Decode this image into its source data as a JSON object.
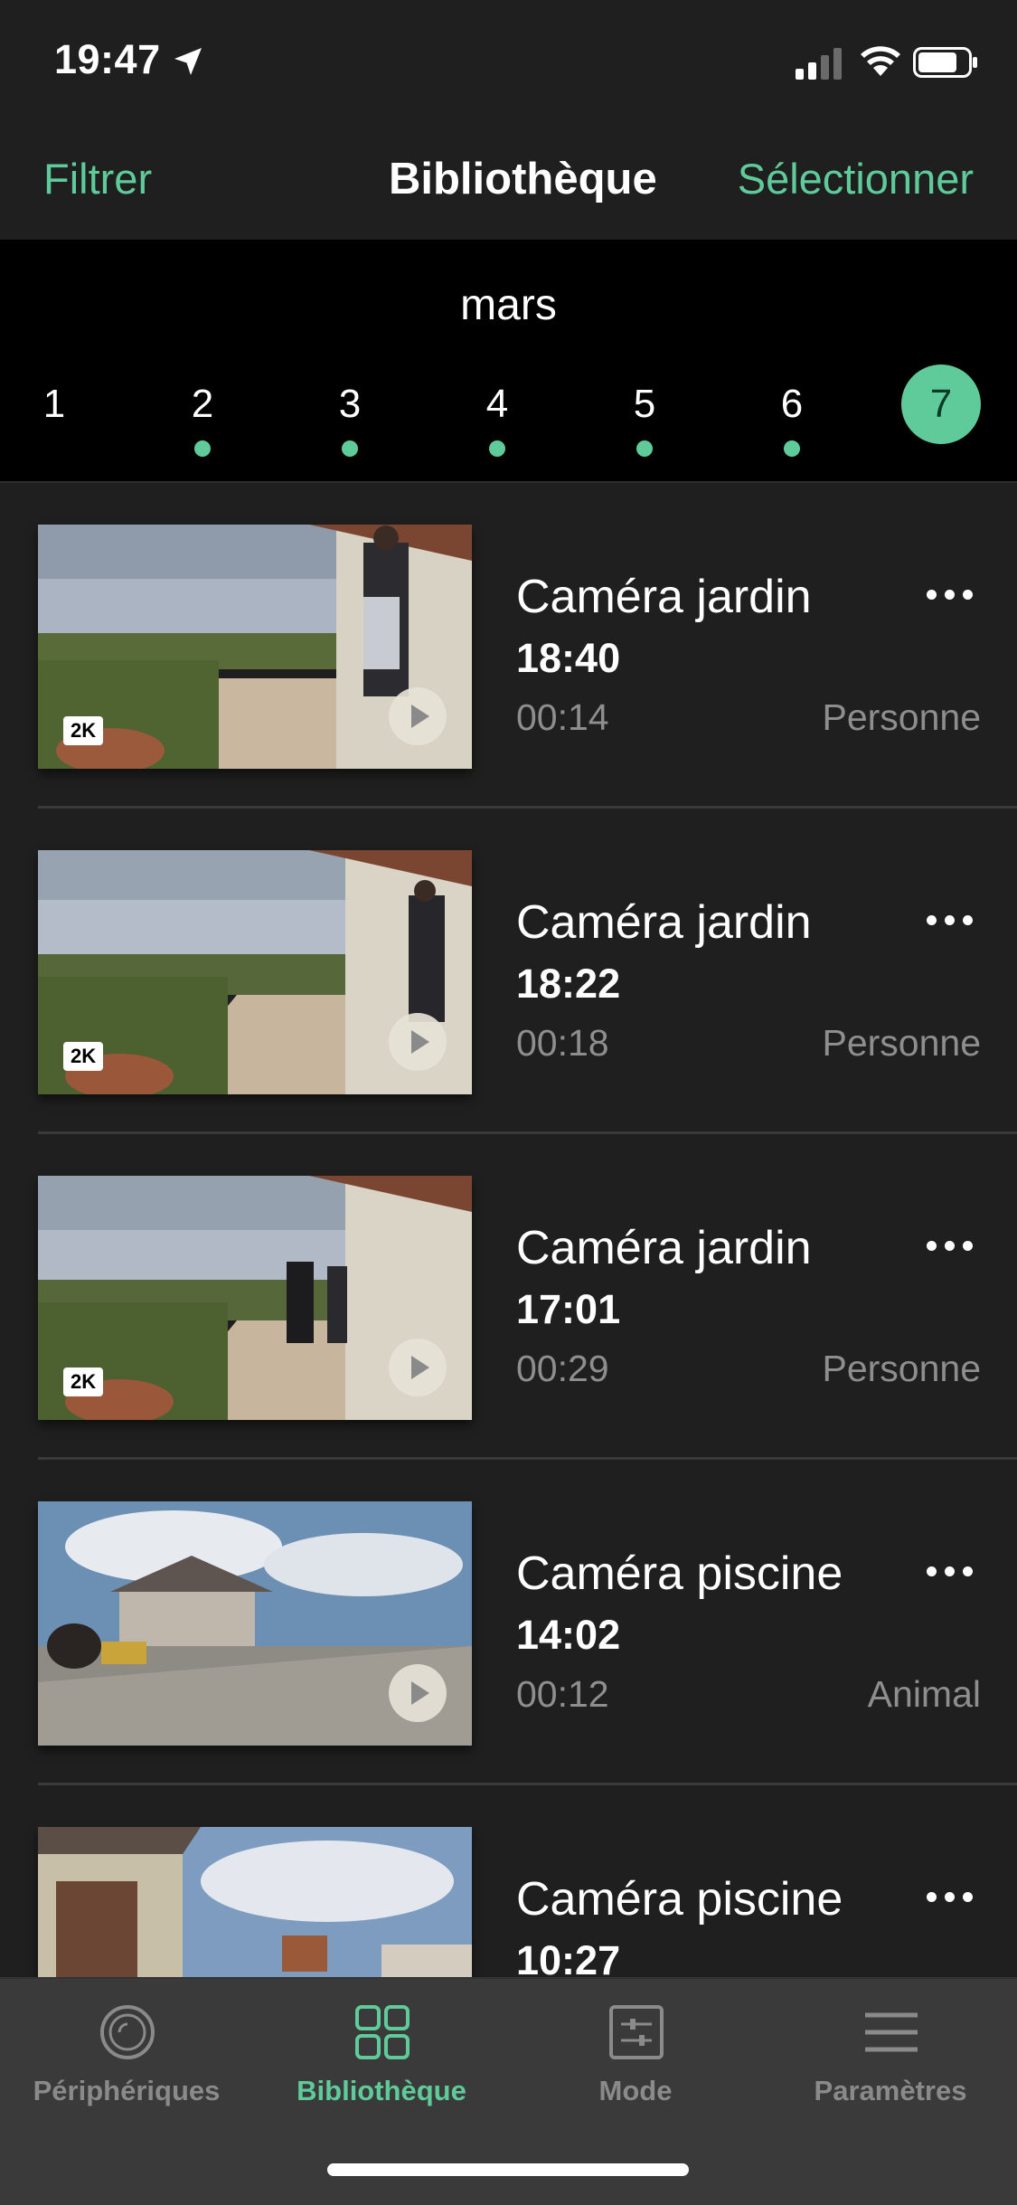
{
  "status_bar": {
    "time": "19:47"
  },
  "header": {
    "filter_label": "Filtrer",
    "title": "Bibliothèque",
    "select_label": "Sélectionner"
  },
  "calendar": {
    "month": "mars",
    "days": [
      {
        "label": "1",
        "has_event": false,
        "selected": false
      },
      {
        "label": "2",
        "has_event": true,
        "selected": false
      },
      {
        "label": "3",
        "has_event": true,
        "selected": false
      },
      {
        "label": "4",
        "has_event": true,
        "selected": false
      },
      {
        "label": "5",
        "has_event": true,
        "selected": false
      },
      {
        "label": "6",
        "has_event": true,
        "selected": false
      },
      {
        "label": "7",
        "has_event": false,
        "selected": true
      }
    ]
  },
  "recordings": [
    {
      "camera": "Caméra jardin",
      "time": "18:40",
      "duration": "00:14",
      "tag": "Personne",
      "badge": "2K"
    },
    {
      "camera": "Caméra jardin",
      "time": "18:22",
      "duration": "00:18",
      "tag": "Personne",
      "badge": "2K"
    },
    {
      "camera": "Caméra jardin",
      "time": "17:01",
      "duration": "00:29",
      "tag": "Personne",
      "badge": "2K"
    },
    {
      "camera": "Caméra piscine",
      "time": "14:02",
      "duration": "00:12",
      "tag": "Animal",
      "badge": ""
    },
    {
      "camera": "Caméra piscine",
      "time": "10:27",
      "duration": "",
      "tag": "",
      "badge": ""
    }
  ],
  "tabbar": {
    "tabs": [
      {
        "label": "Périphériques",
        "icon": "devices-icon"
      },
      {
        "label": "Bibliothèque",
        "icon": "library-grid-icon",
        "active": true
      },
      {
        "label": "Mode",
        "icon": "mode-sliders-icon"
      },
      {
        "label": "Paramètres",
        "icon": "menu-lines-icon"
      }
    ]
  },
  "colors": {
    "accent": "#5fcb9b",
    "background": "#1f1f1f",
    "secondary_text": "#8e8e8e",
    "tabbar": "#3a3a3a"
  }
}
